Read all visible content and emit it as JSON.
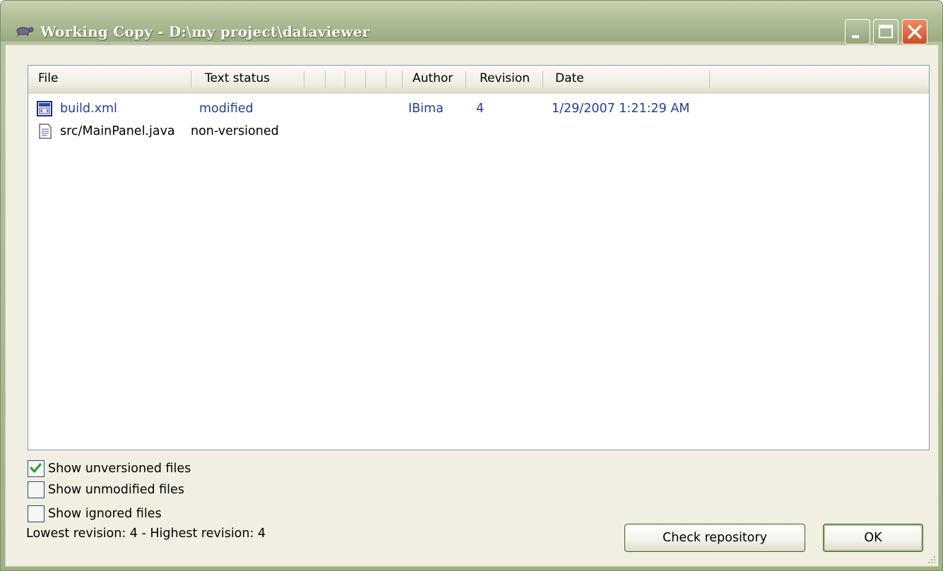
{
  "window": {
    "title": "Working Copy - D:\\my project\\dataviewer",
    "buttons": {
      "minimize": "minimize-icon",
      "maximize": "maximize-icon",
      "close": "close-icon"
    }
  },
  "list": {
    "columns": [
      "File",
      "Text status",
      "",
      "",
      "",
      "",
      "Author",
      "Revision",
      "Date"
    ],
    "rows": [
      {
        "file": "build.xml",
        "icon": "xml-file-icon",
        "status": "modified",
        "author": "IBima",
        "revision": "4",
        "date": "1/29/2007 1:21:29 AM"
      },
      {
        "file": "src/MainPanel.java",
        "icon": "text-file-icon",
        "status": "non-versioned",
        "author": "",
        "revision": "",
        "date": ""
      }
    ]
  },
  "options": {
    "show_unversioned": {
      "label": "Show unversioned files",
      "checked": true
    },
    "show_unmodified": {
      "label": "Show unmodified files",
      "checked": false
    },
    "show_ignored": {
      "label": "Show ignored files",
      "checked": false
    }
  },
  "status_text": "Lowest revision: 4 - Highest revision: 4",
  "buttons": {
    "check_repository": "Check repository",
    "ok": "OK"
  },
  "colors": {
    "title_bar": "#a6b68c",
    "link_blue": "#1f3ea8",
    "close_red": "#d24a24"
  }
}
